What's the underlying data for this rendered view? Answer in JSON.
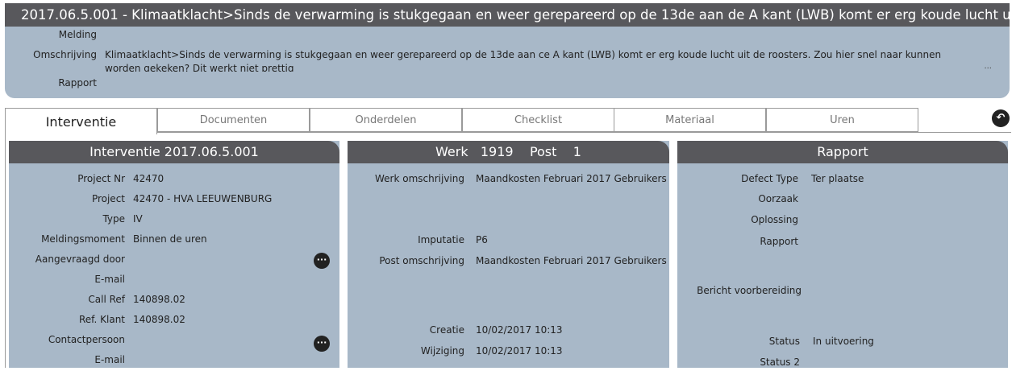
{
  "header": {
    "title": "2017.06.5.001 - Klimaatklacht>Sinds de verwarming is stukgegaan en weer gerepareerd op de 13de aan de A kant (LWB) komt er erg koude lucht uit de roosters.",
    "melding_label": "Melding",
    "melding_value": "",
    "omschrijving_label": "Omschrijving",
    "omschrijving_value": "Klimaatklacht>Sinds de verwarming is stukgegaan en weer gerepareerd op de 13de aan ce A kant (LWB) komt er erg koude lucht uit de roosters. Zou hier snel naar kunnen worden gekeken? Dit werkt niet prettig",
    "ellipsis": "...",
    "rapport_label": "Rapport",
    "rapport_value": ""
  },
  "tabs": [
    {
      "label": "Interventie",
      "active": true
    },
    {
      "label": "Documenten",
      "active": false
    },
    {
      "label": "Onderdelen",
      "active": false
    },
    {
      "label": "Checklist",
      "active": false
    },
    {
      "label": "Materiaal",
      "active": false
    },
    {
      "label": "Uren",
      "active": false
    }
  ],
  "back_button": "↶",
  "interventie": {
    "title": "Interventie 2017.06.5.001",
    "fields": [
      {
        "label": "Project Nr",
        "value": "42470"
      },
      {
        "label": "Project",
        "value": "42470 - HVA  LEEUWENBURG"
      },
      {
        "label": "Type",
        "value": "IV"
      },
      {
        "label": "Meldingsmoment",
        "value": "Binnen de uren"
      },
      {
        "label": "Aangevraagd door",
        "value": ""
      },
      {
        "label": "E-mail",
        "value": ""
      },
      {
        "label": "Call Ref",
        "value": "140898.02"
      },
      {
        "label": "Ref. Klant",
        "value": "140898.02"
      },
      {
        "label": "Contactpersoon",
        "value": ""
      },
      {
        "label": "E-mail",
        "value": ""
      }
    ],
    "more_label": "···"
  },
  "werk": {
    "title": "Werk   1919    Post    1",
    "werk_omschrijving_label": "Werk omschrijving",
    "werk_omschrijving_value": "Maandkosten Februari 2017 Gebruikers",
    "imputatie_label": "Imputatie",
    "imputatie_value": "P6",
    "post_omschrijving_label": "Post omschrijving",
    "post_omschrijving_value": "Maandkosten Februari 2017 Gebruikers",
    "creatie_label": "Creatie",
    "creatie_value": "10/02/2017 10:13",
    "wijziging_label": "Wijziging",
    "wijziging_value": "10/02/2017 10:13"
  },
  "rapport": {
    "title": "Rapport",
    "defect_type_label": "Defect Type",
    "defect_type_value": "Ter plaatse",
    "oorzaak_label": "Oorzaak",
    "oplossing_label": "Oplossing",
    "rapport_label": "Rapport",
    "bericht_label": "Bericht voorbereiding",
    "status_label": "Status",
    "status_value": "In uitvoering",
    "status2_label": "Status 2"
  }
}
